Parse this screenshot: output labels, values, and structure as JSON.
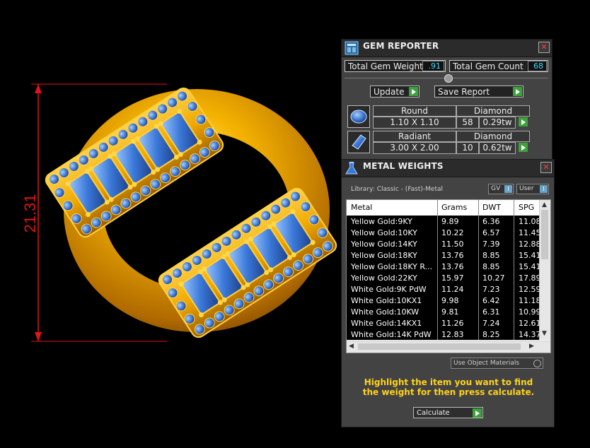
{
  "viewport": {
    "dimension_label": "21.31",
    "colors": {
      "gold": "#f0a800",
      "stone": "#3a78d8",
      "dimension": "#e0141a"
    }
  },
  "gem_reporter": {
    "title": "GEM REPORTER",
    "total_weight_label": "Total Gem Weight",
    "total_weight_value": ".91",
    "total_count_label": "Total Gem Count",
    "total_count_value": "68",
    "update_label": "Update",
    "save_report_label": "Save Report",
    "gems": [
      {
        "shape": "Round",
        "type": "Diamond",
        "size": "1.10 X 1.10",
        "count": "58",
        "weight": "0.29tw",
        "icon": "round-gem-icon"
      },
      {
        "shape": "Radiant",
        "type": "Diamond",
        "size": "3.00 X 2.00",
        "count": "10",
        "weight": "0.62tw",
        "icon": "radiant-gem-icon"
      }
    ]
  },
  "metal_weights": {
    "title": "METAL WEIGHTS",
    "library": "Library: Classic - (Fast)-Metal",
    "gv_label": "GV",
    "user_label": "User",
    "columns": [
      "Metal",
      "Grams",
      "DWT",
      "SPG"
    ],
    "rows": [
      [
        "Yellow Gold:9KY",
        "9.89",
        "6.36",
        "11.08"
      ],
      [
        "Yellow Gold:10KY",
        "10.22",
        "6.57",
        "11.45"
      ],
      [
        "Yellow Gold:14KY",
        "11.50",
        "7.39",
        "12.88"
      ],
      [
        "Yellow Gold:18KY",
        "13.76",
        "8.85",
        "15.41"
      ],
      [
        "Yellow Gold:18KY R...",
        "13.76",
        "8.85",
        "15.41"
      ],
      [
        "Yellow Gold:22KY",
        "15.97",
        "10.27",
        "17.89"
      ],
      [
        "White Gold:9K PdW",
        "11.24",
        "7.23",
        "12.59"
      ],
      [
        "White Gold:10KX1",
        "9.98",
        "6.42",
        "11.18"
      ],
      [
        "White Gold:10KW",
        "9.81",
        "6.31",
        "10.99"
      ],
      [
        "White Gold:14KX1",
        "11.26",
        "7.24",
        "12.61"
      ],
      [
        "White Gold:14K PdW",
        "12.83",
        "8.25",
        "14.37"
      ]
    ],
    "use_object_materials_label": "Use Object Materials",
    "instruction": "Highlight the item you want to find the weight for then press calculate.",
    "calculate_label": "Calculate"
  }
}
